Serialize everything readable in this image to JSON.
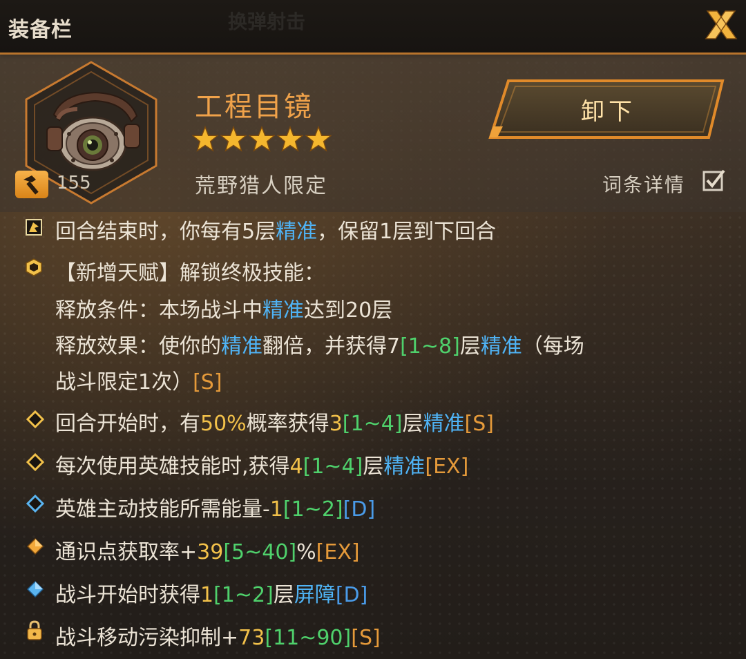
{
  "header": {
    "title": "装备栏",
    "background_text": "换弹射击"
  },
  "item": {
    "name": "工程目镜",
    "stars": 5,
    "subtitle": "荒野猎人限定",
    "level": "155"
  },
  "actions": {
    "unequip_label": "卸下",
    "details_label": "词条详情",
    "details_checked": true
  },
  "effects": {
    "talent_unique": {
      "p1": "回合结束时，你每有5层",
      "kw": "精准",
      "p2": "，保留1层到下回合"
    },
    "new_talent": {
      "header": "【新增天赋】解锁终极技能：",
      "cond_p1": "释放条件：本场战斗中",
      "cond_kw": "精准",
      "cond_p2": "达到20层",
      "eff_p1": "释放效果：使你的",
      "eff_kw1": "精准",
      "eff_p2": "翻倍，并获得7",
      "eff_range": "[1~8]",
      "eff_p3": "层",
      "eff_kw2": "精准",
      "eff_p4": "（每场",
      "eff_line2": "战斗限定1次）",
      "eff_tier": "[S]"
    },
    "stats": [
      {
        "p1": "回合开始时，有",
        "val1": "50%",
        "p2": "概率获得",
        "val2": "3",
        "range": "[1~4]",
        "p3": "层",
        "kw": "精准",
        "tier": "[S]"
      },
      {
        "p1": "每次使用英雄技能时,获得",
        "val": "4",
        "range": "[1~4]",
        "p2": "层",
        "kw": "精准",
        "tier": "[EX]"
      },
      {
        "p1": "英雄主动技能所需能量-",
        "val": "1",
        "range": "[1~2]",
        "tier": "[D]"
      },
      {
        "p1": "通识点获取率+",
        "val": "39",
        "range": "[5~40]",
        "p2": "%",
        "tier": "[EX]"
      },
      {
        "p1": "战斗开始时获得",
        "val": "1",
        "range": "[1~2]",
        "p2": "层",
        "kw": "屏障",
        "tier": "[D]"
      },
      {
        "p1": "战斗移动污染抑制+",
        "val": "73",
        "range": "[11~90]",
        "tier": "[S]"
      }
    ]
  },
  "colors": {
    "accent": "#f0a24a",
    "keyword_blue": "#4fb3f5",
    "value_gold": "#f2c14a",
    "range_green": "#4fd16c",
    "tier_orange": "#e59a3a",
    "tier_blue": "#4a9be8"
  }
}
